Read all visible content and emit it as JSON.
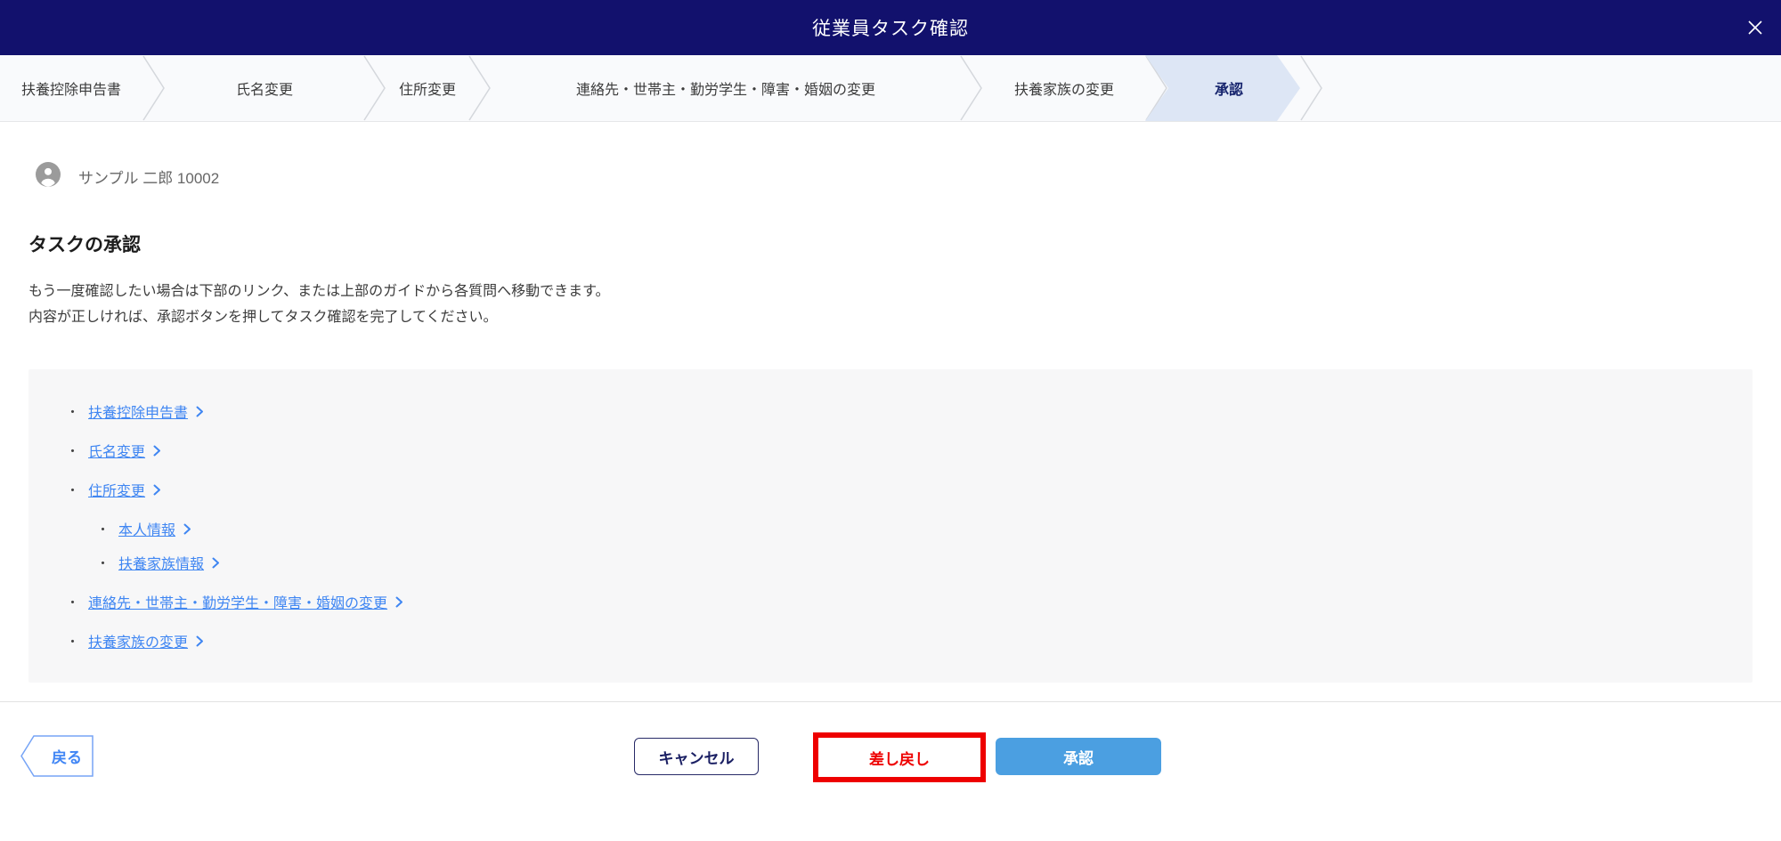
{
  "header": {
    "title": "従業員タスク確認"
  },
  "stepper": {
    "steps": [
      {
        "label": "扶養控除申告書",
        "active": false
      },
      {
        "label": "氏名変更",
        "active": false
      },
      {
        "label": "住所変更",
        "active": false
      },
      {
        "label": "連絡先・世帯主・勤労学生・障害・婚姻の変更",
        "active": false
      },
      {
        "label": "扶養家族の変更",
        "active": false
      },
      {
        "label": "承認",
        "active": true
      }
    ]
  },
  "user": {
    "name": "サンプル 二郎 10002"
  },
  "main": {
    "heading": "タスクの承認",
    "description_lines": [
      "もう一度確認したい場合は下部のリンク、または上部のガイドから各質問へ移動できます。",
      "内容が正しければ、承認ボタンを押してタスク確認を完了してください。"
    ],
    "links": [
      {
        "label": "扶養控除申告書",
        "level": 1
      },
      {
        "label": "氏名変更",
        "level": 1
      },
      {
        "label": "住所変更",
        "level": 1
      },
      {
        "label": "本人情報",
        "level": 2
      },
      {
        "label": "扶養家族情報",
        "level": 2
      },
      {
        "label": "連絡先・世帯主・勤労学生・障害・婚姻の変更",
        "level": 1
      },
      {
        "label": "扶養家族の変更",
        "level": 1
      }
    ],
    "bullet_char": "・"
  },
  "footer": {
    "back_label": "戻る",
    "cancel_label": "キャンセル",
    "sendback_label": "差し戻し",
    "approve_label": "承認"
  },
  "colors": {
    "header_navy": "#12116d",
    "active_step_fill": "#dde6f5",
    "active_step_text": "#16246d",
    "link_blue": "#3f86f2",
    "annotation_red": "#ee0000",
    "approve_blue": "#4b9fe1"
  }
}
